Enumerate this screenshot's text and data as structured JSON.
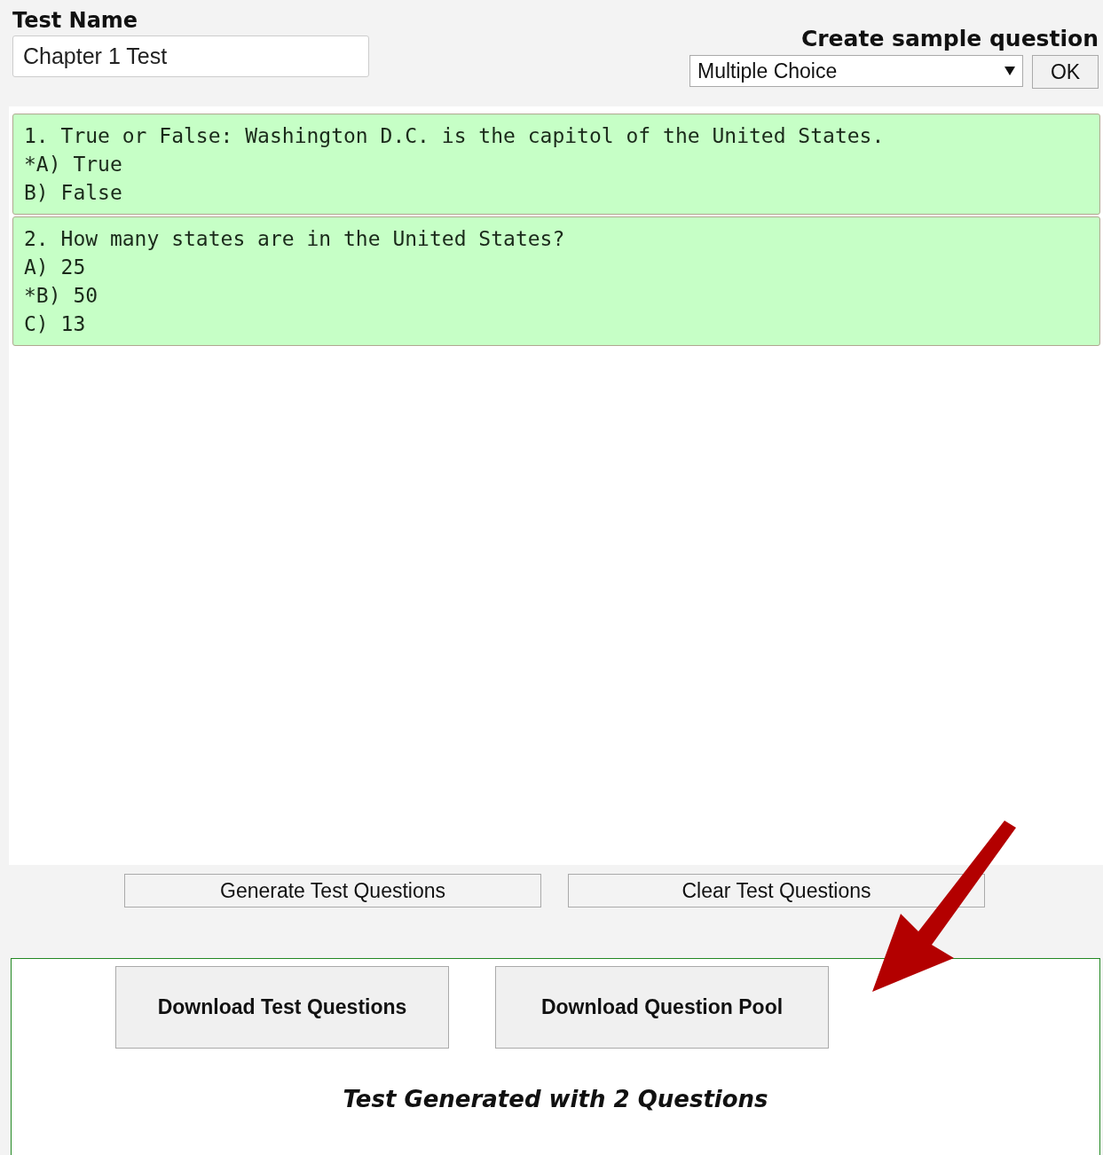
{
  "test_name": {
    "label": "Test Name",
    "value": "Chapter 1 Test"
  },
  "sample": {
    "label": "Create sample question",
    "type_select": "Multiple Choice",
    "ok": "OK"
  },
  "questions": [
    {
      "lines": [
        "1. True or False: Washington D.C. is the capitol of the United States.",
        "*A) True",
        "B) False"
      ]
    },
    {
      "lines": [
        "2. How many states are in the United States?",
        "A) 25",
        "*B) 50",
        "C) 13"
      ]
    }
  ],
  "actions": [
    "Generate Test Questions",
    "Clear Test Questions"
  ],
  "downloads": [
    "Download Test Questions",
    "Download Question Pool"
  ],
  "status": "Test Generated with 2 Questions"
}
